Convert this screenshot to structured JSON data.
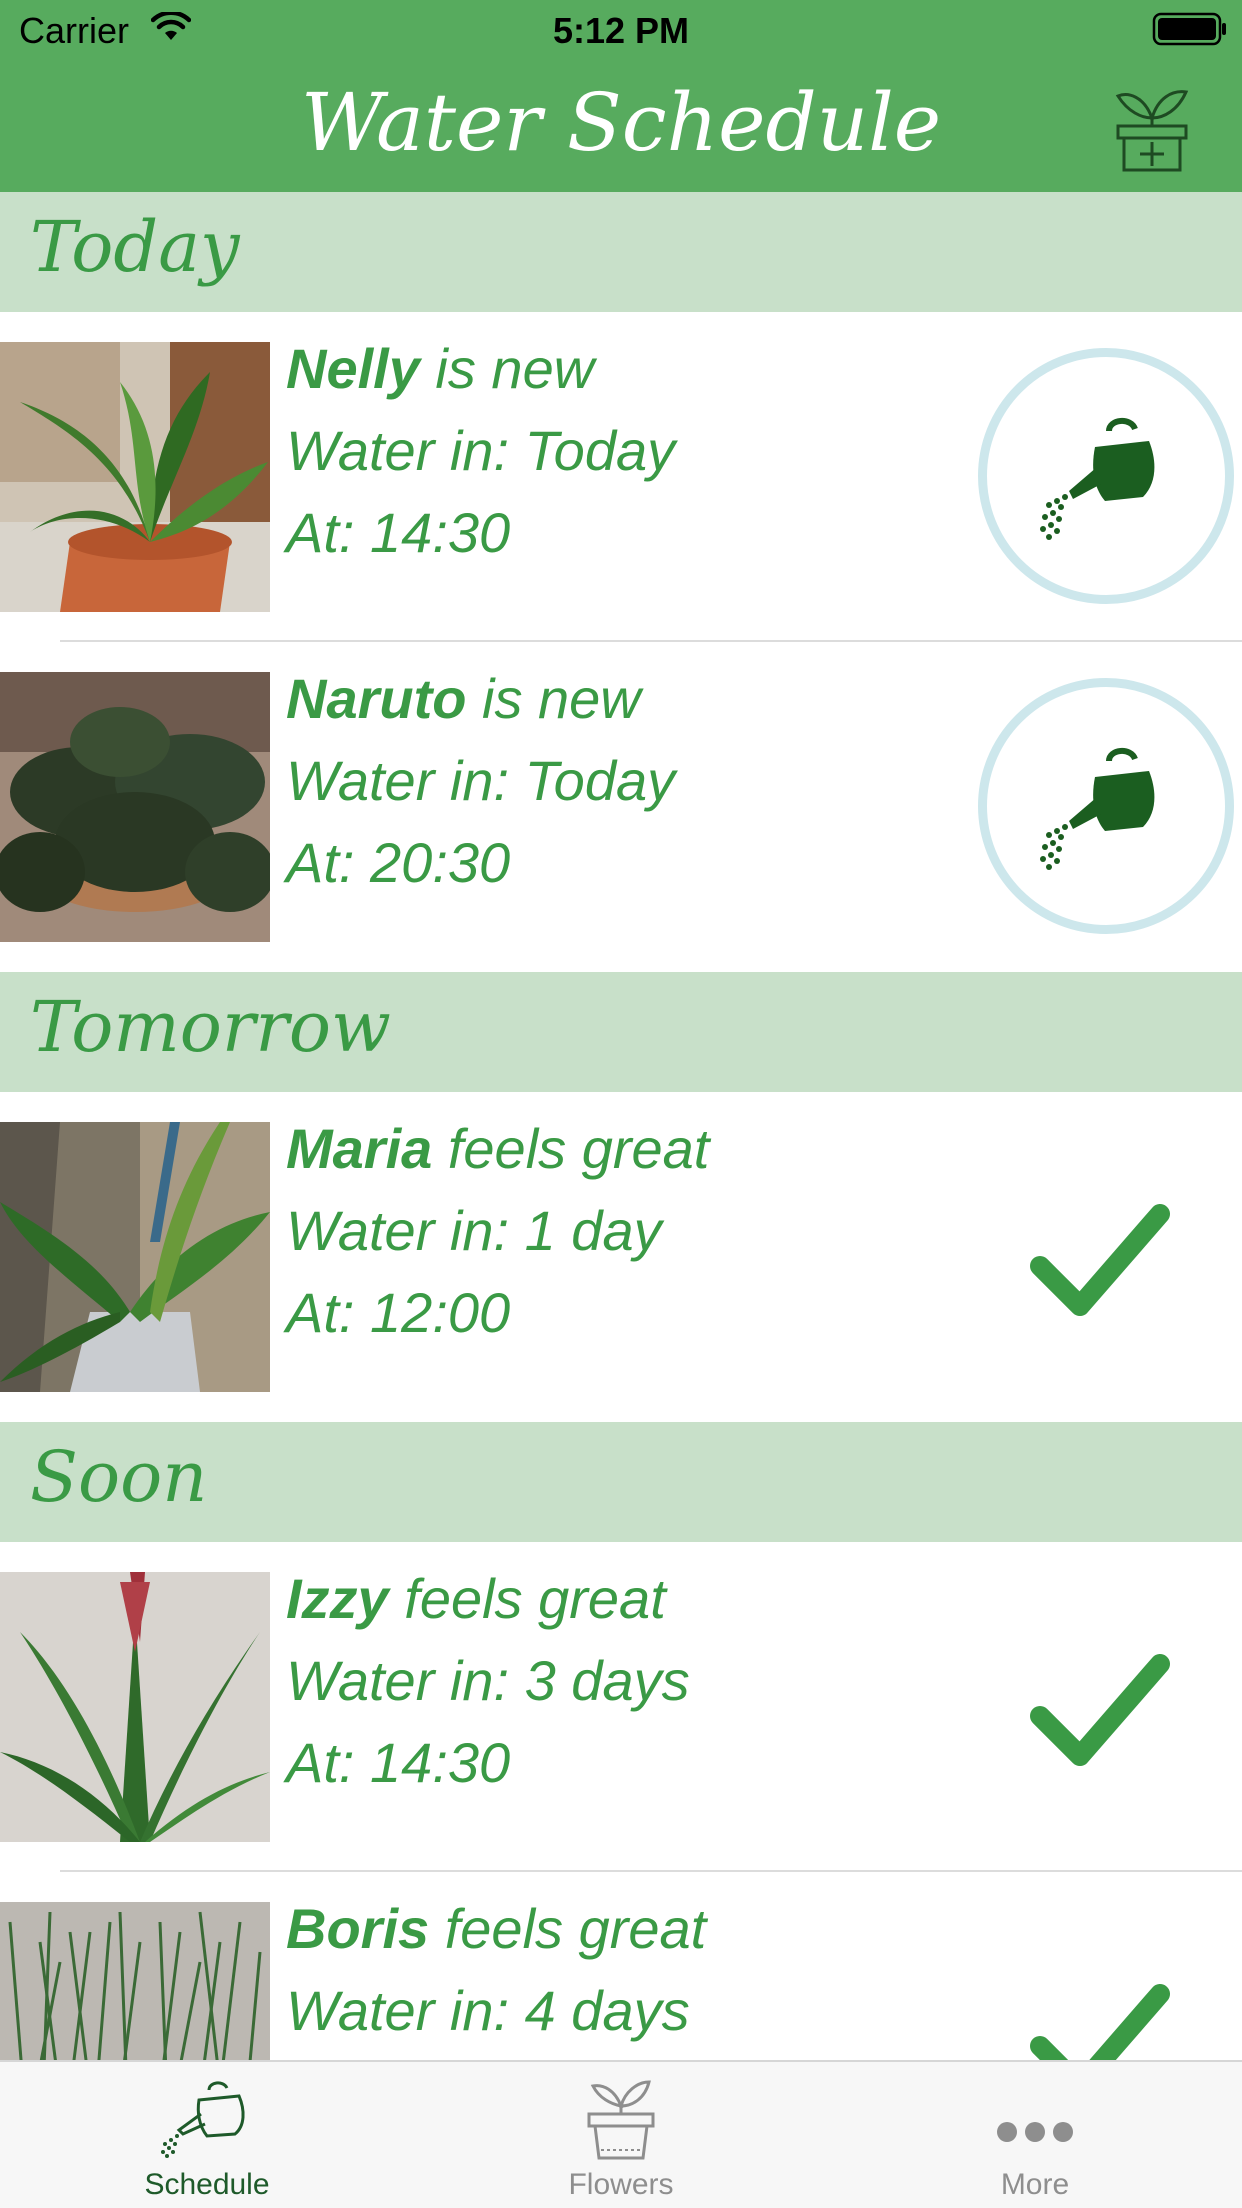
{
  "status_bar": {
    "carrier": "Carrier",
    "time": "5:12 PM"
  },
  "nav": {
    "title": "Water Schedule",
    "add_icon": "add-plant-icon"
  },
  "sections": [
    {
      "title": "Today"
    },
    {
      "title": "Tomorrow"
    },
    {
      "title": "Soon"
    }
  ],
  "rows": [
    {
      "name": "Nelly",
      "status": " is new",
      "water_in": "Water in: Today",
      "at": "At: 14:30",
      "action": "water"
    },
    {
      "name": "Naruto",
      "status": " is new",
      "water_in": "Water in: Today",
      "at": "At: 20:30",
      "action": "water"
    },
    {
      "name": "Maria",
      "status": " feels great",
      "water_in": "Water in: 1 day",
      "at": "At: 12:00",
      "action": "done"
    },
    {
      "name": "Izzy",
      "status": " feels great",
      "water_in": "Water in: 3 days",
      "at": "At: 14:30",
      "action": "done"
    },
    {
      "name": "Boris",
      "status": " feels great",
      "water_in": "Water in: 4 days",
      "at": "",
      "action": "done"
    }
  ],
  "tabbar": {
    "tabs": [
      {
        "label": "Schedule",
        "icon": "watering-can-icon",
        "active": true
      },
      {
        "label": "Flowers",
        "icon": "plant-pot-icon",
        "active": false
      },
      {
        "label": "More",
        "icon": "more-dots-icon",
        "active": false
      }
    ]
  },
  "colors": {
    "header": "#57AB5E",
    "section": "#C8E0C9",
    "accent_text": "#3A9A45",
    "ring": "#CDE7EC",
    "check": "#3A9A45"
  }
}
